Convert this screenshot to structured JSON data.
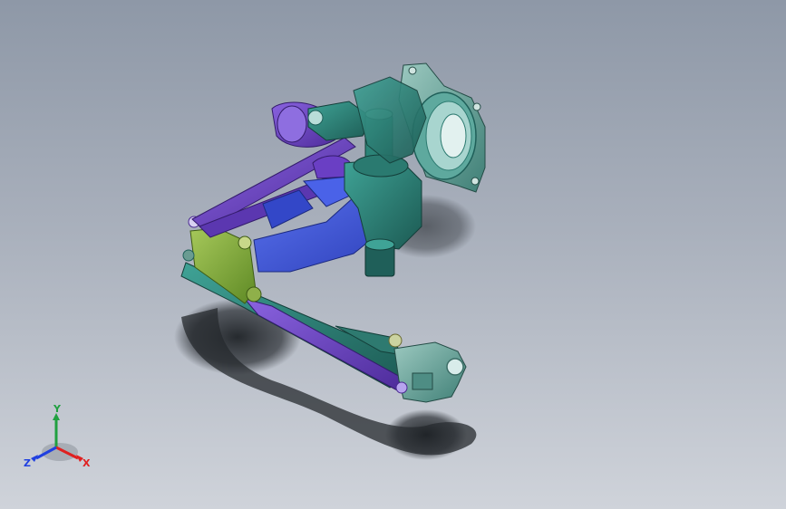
{
  "viewport": {
    "background_top": "#8e98a7",
    "background_bottom": "#cfd3da"
  },
  "model": {
    "colors": {
      "arm_purple": "#6a3fc4",
      "arm_purple_dark": "#4b2a92",
      "body_blue": "#3d55e0",
      "body_teal": "#2f8d83",
      "body_teal_dark": "#1f5f59",
      "knuckle_teal": "#5d9f95",
      "bracket_green": "#7ea83a",
      "shadow": "#2a2e33"
    }
  },
  "triad": {
    "x_label": "X",
    "y_label": "Y",
    "z_label": "Z",
    "x_color": "#e02020",
    "y_color": "#20a040",
    "z_color": "#2040e0"
  }
}
